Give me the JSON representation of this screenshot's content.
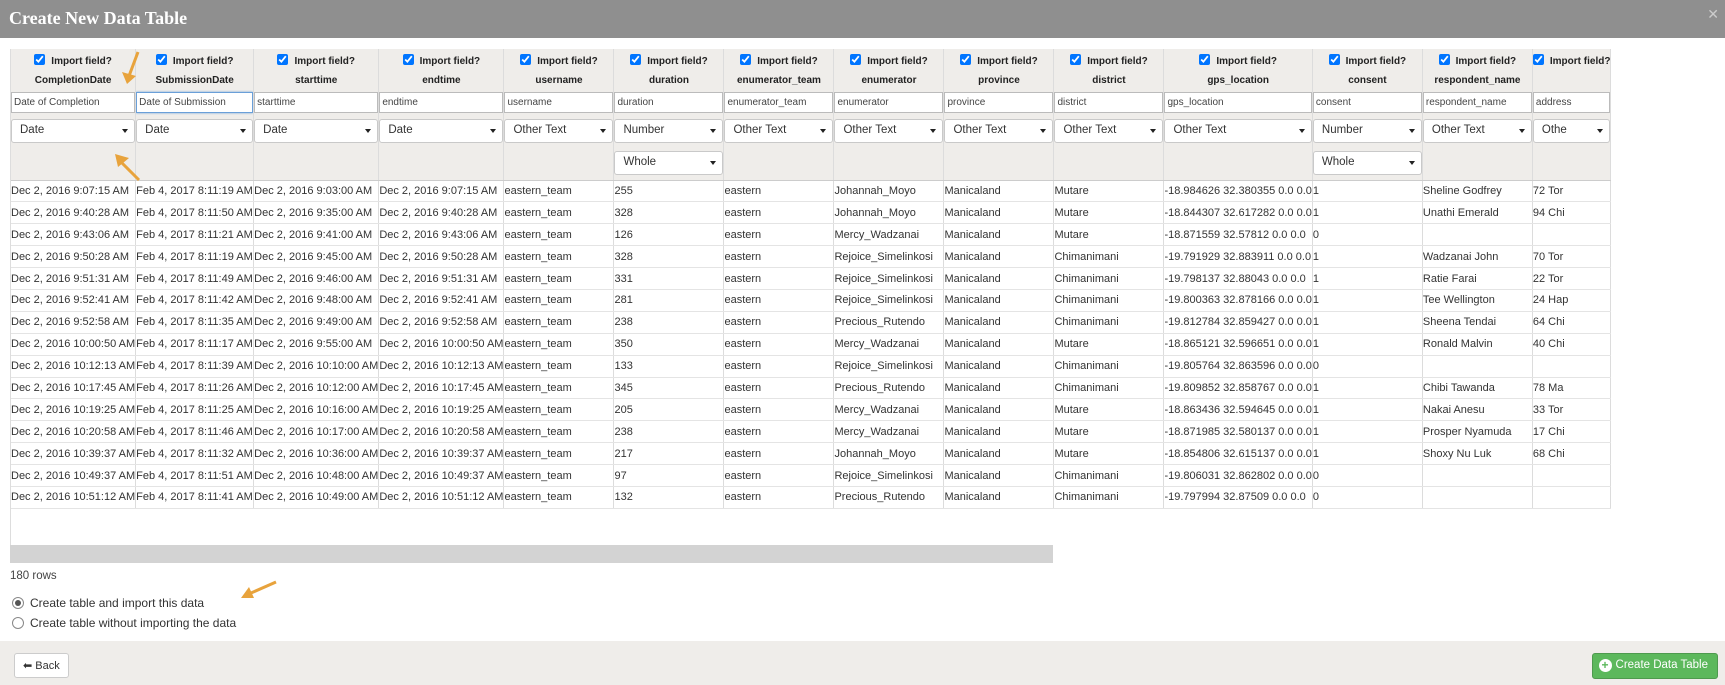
{
  "dialog": {
    "title": "Create New Data Table",
    "close_icon": "close-icon"
  },
  "import_label": "Import field?",
  "columns": [
    {
      "name": "CompletionDate",
      "label": "Date of Completion",
      "type": "Date",
      "sub": ""
    },
    {
      "name": "SubmissionDate",
      "label": "Date of Submission",
      "type": "Date",
      "sub": ""
    },
    {
      "name": "starttime",
      "label": "starttime",
      "type": "Date",
      "sub": ""
    },
    {
      "name": "endtime",
      "label": "endtime",
      "type": "Date",
      "sub": ""
    },
    {
      "name": "username",
      "label": "username",
      "type": "Other Text",
      "sub": ""
    },
    {
      "name": "duration",
      "label": "duration",
      "type": "Number",
      "sub": "Whole"
    },
    {
      "name": "enumerator_team",
      "label": "enumerator_team",
      "type": "Other Text",
      "sub": ""
    },
    {
      "name": "enumerator",
      "label": "enumerator",
      "type": "Other Text",
      "sub": ""
    },
    {
      "name": "province",
      "label": "province",
      "type": "Other Text",
      "sub": ""
    },
    {
      "name": "district",
      "label": "district",
      "type": "Other Text",
      "sub": ""
    },
    {
      "name": "gps_location",
      "label": "gps_location",
      "type": "Other Text",
      "sub": ""
    },
    {
      "name": "consent",
      "label": "consent",
      "type": "Number",
      "sub": "Whole"
    },
    {
      "name": "respondent_name",
      "label": "respondent_name",
      "type": "Other Text",
      "sub": ""
    },
    {
      "name": "",
      "label": "address",
      "type": "Othe",
      "sub": ""
    }
  ],
  "rows": [
    [
      "Dec 2, 2016 9:07:15 AM",
      "Feb 4, 2017 8:11:19 AM",
      "Dec 2, 2016 9:03:00 AM",
      "Dec 2, 2016 9:07:15 AM",
      "eastern_team",
      "255",
      "eastern",
      "Johannah_Moyo",
      "Manicaland",
      "Mutare",
      "-18.984626 32.380355 0.0 0.0",
      "1",
      "Sheline Godfrey",
      "72 Tor"
    ],
    [
      "Dec 2, 2016 9:40:28 AM",
      "Feb 4, 2017 8:11:50 AM",
      "Dec 2, 2016 9:35:00 AM",
      "Dec 2, 2016 9:40:28 AM",
      "eastern_team",
      "328",
      "eastern",
      "Johannah_Moyo",
      "Manicaland",
      "Mutare",
      "-18.844307 32.617282 0.0 0.0",
      "1",
      "Unathi Emerald",
      "94 Chi"
    ],
    [
      "Dec 2, 2016 9:43:06 AM",
      "Feb 4, 2017 8:11:21 AM",
      "Dec 2, 2016 9:41:00 AM",
      "Dec 2, 2016 9:43:06 AM",
      "eastern_team",
      "126",
      "eastern",
      "Mercy_Wadzanai",
      "Manicaland",
      "Mutare",
      "-18.871559 32.57812 0.0 0.0",
      "0",
      "",
      ""
    ],
    [
      "Dec 2, 2016 9:50:28 AM",
      "Feb 4, 2017 8:11:19 AM",
      "Dec 2, 2016 9:45:00 AM",
      "Dec 2, 2016 9:50:28 AM",
      "eastern_team",
      "328",
      "eastern",
      "Rejoice_Simelinkosi",
      "Manicaland",
      "Chimanimani",
      "-19.791929 32.883911 0.0 0.0",
      "1",
      "Wadzanai John",
      "70 Tor"
    ],
    [
      "Dec 2, 2016 9:51:31 AM",
      "Feb 4, 2017 8:11:49 AM",
      "Dec 2, 2016 9:46:00 AM",
      "Dec 2, 2016 9:51:31 AM",
      "eastern_team",
      "331",
      "eastern",
      "Rejoice_Simelinkosi",
      "Manicaland",
      "Chimanimani",
      "-19.798137 32.88043 0.0 0.0",
      "1",
      "Ratie Farai",
      "22 Tor"
    ],
    [
      "Dec 2, 2016 9:52:41 AM",
      "Feb 4, 2017 8:11:42 AM",
      "Dec 2, 2016 9:48:00 AM",
      "Dec 2, 2016 9:52:41 AM",
      "eastern_team",
      "281",
      "eastern",
      "Rejoice_Simelinkosi",
      "Manicaland",
      "Chimanimani",
      "-19.800363 32.878166 0.0 0.0",
      "1",
      "Tee Wellington",
      "24 Hap"
    ],
    [
      "Dec 2, 2016 9:52:58 AM",
      "Feb 4, 2017 8:11:35 AM",
      "Dec 2, 2016 9:49:00 AM",
      "Dec 2, 2016 9:52:58 AM",
      "eastern_team",
      "238",
      "eastern",
      "Precious_Rutendo",
      "Manicaland",
      "Chimanimani",
      "-19.812784 32.859427 0.0 0.0",
      "1",
      "Sheena Tendai",
      "64 Chi"
    ],
    [
      "Dec 2, 2016 10:00:50 AM",
      "Feb 4, 2017 8:11:17 AM",
      "Dec 2, 2016 9:55:00 AM",
      "Dec 2, 2016 10:00:50 AM",
      "eastern_team",
      "350",
      "eastern",
      "Mercy_Wadzanai",
      "Manicaland",
      "Mutare",
      "-18.865121 32.596651 0.0 0.0",
      "1",
      "Ronald Malvin",
      "40 Chi"
    ],
    [
      "Dec 2, 2016 10:12:13 AM",
      "Feb 4, 2017 8:11:39 AM",
      "Dec 2, 2016 10:10:00 AM",
      "Dec 2, 2016 10:12:13 AM",
      "eastern_team",
      "133",
      "eastern",
      "Rejoice_Simelinkosi",
      "Manicaland",
      "Chimanimani",
      "-19.805764 32.863596 0.0 0.0",
      "0",
      "",
      ""
    ],
    [
      "Dec 2, 2016 10:17:45 AM",
      "Feb 4, 2017 8:11:26 AM",
      "Dec 2, 2016 10:12:00 AM",
      "Dec 2, 2016 10:17:45 AM",
      "eastern_team",
      "345",
      "eastern",
      "Precious_Rutendo",
      "Manicaland",
      "Chimanimani",
      "-19.809852 32.858767 0.0 0.0",
      "1",
      "Chibi Tawanda",
      "78 Ma"
    ],
    [
      "Dec 2, 2016 10:19:25 AM",
      "Feb 4, 2017 8:11:25 AM",
      "Dec 2, 2016 10:16:00 AM",
      "Dec 2, 2016 10:19:25 AM",
      "eastern_team",
      "205",
      "eastern",
      "Mercy_Wadzanai",
      "Manicaland",
      "Mutare",
      "-18.863436 32.594645 0.0 0.0",
      "1",
      "Nakai Anesu",
      "33 Tor"
    ],
    [
      "Dec 2, 2016 10:20:58 AM",
      "Feb 4, 2017 8:11:46 AM",
      "Dec 2, 2016 10:17:00 AM",
      "Dec 2, 2016 10:20:58 AM",
      "eastern_team",
      "238",
      "eastern",
      "Mercy_Wadzanai",
      "Manicaland",
      "Mutare",
      "-18.871985 32.580137 0.0 0.0",
      "1",
      "Prosper Nyamuda",
      "17 Chi"
    ],
    [
      "Dec 2, 2016 10:39:37 AM",
      "Feb 4, 2017 8:11:32 AM",
      "Dec 2, 2016 10:36:00 AM",
      "Dec 2, 2016 10:39:37 AM",
      "eastern_team",
      "217",
      "eastern",
      "Johannah_Moyo",
      "Manicaland",
      "Mutare",
      "-18.854806 32.615137 0.0 0.0",
      "1",
      "Shoxy Nu Luk",
      "68 Chi"
    ],
    [
      "Dec 2, 2016 10:49:37 AM",
      "Feb 4, 2017 8:11:51 AM",
      "Dec 2, 2016 10:48:00 AM",
      "Dec 2, 2016 10:49:37 AM",
      "eastern_team",
      "97",
      "eastern",
      "Rejoice_Simelinkosi",
      "Manicaland",
      "Chimanimani",
      "-19.806031 32.862802 0.0 0.0",
      "0",
      "",
      ""
    ],
    [
      "Dec 2, 2016 10:51:12 AM",
      "Feb 4, 2017 8:11:41 AM",
      "Dec 2, 2016 10:49:00 AM",
      "Dec 2, 2016 10:51:12 AM",
      "eastern_team",
      "132",
      "eastern",
      "Precious_Rutendo",
      "Manicaland",
      "Chimanimani",
      "-19.797994 32.87509 0.0 0.0",
      "0",
      "",
      ""
    ]
  ],
  "row_count": "180 rows",
  "options": {
    "import": "Create table and import this data",
    "no_import": "Create table without importing the data",
    "selected": "import"
  },
  "footer": {
    "back_label": "Back",
    "create_label": "Create Data Table"
  },
  "colors": {
    "titlebar": "#8f8f8f",
    "create_button": "#5cb85c",
    "arrow": "#e8a33c",
    "header_bg": "#efedea"
  }
}
